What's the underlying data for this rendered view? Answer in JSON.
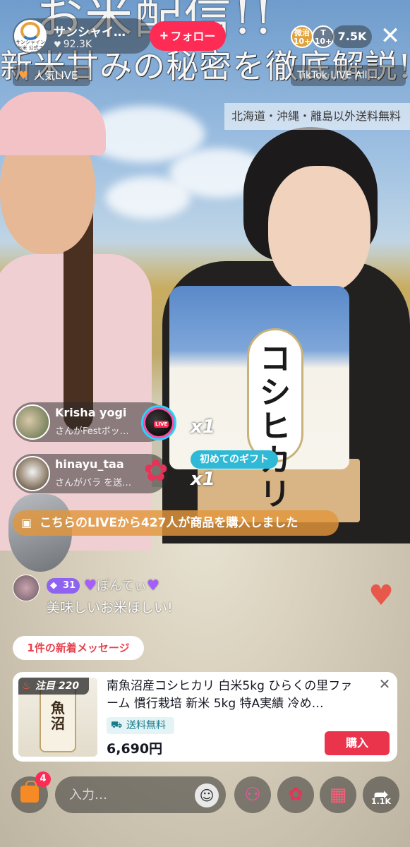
{
  "stream": {
    "overlay_title": "お米配信!!",
    "overlay_subtitle": "新米甘みの秘密を徹底解説!",
    "shipping_banner": "北海道・沖縄・離島以外送料無料",
    "bag_kanji": "コシヒカリ"
  },
  "host": {
    "name": "サンシャイ…",
    "avatar_text": "サンシャインお米 公式ストア",
    "likes": "92.3K",
    "follow_label": "フォロー"
  },
  "top_right": {
    "badge_a": "微治 10+",
    "badge_b": "T 10+",
    "viewers": "7.5K"
  },
  "tags": {
    "popular": "人気LIVE",
    "tiktok": "TikTok LIVE All …"
  },
  "gifts": [
    {
      "user": "Krisha yogi",
      "message": "さんがFestボッ…",
      "combo": "x1",
      "icon": "live-ball-icon"
    },
    {
      "user": "hinayu_taa",
      "message": "さんがバラ を送…",
      "combo": "x1",
      "icon": "rose-icon"
    }
  ],
  "first_gift_label": "初めてのギフト",
  "purchase_banner": "こちらのLIVEから427人が商品を購入しました",
  "comment": {
    "level": "31",
    "user": "ぽんてぃ",
    "text": "美味しいお米ほしい!"
  },
  "new_messages": "1件の新着メッセージ",
  "product": {
    "hot_label": "注目 220",
    "title": "南魚沼産コシヒカリ 白米5kg ひらくの里ファーム 慣行栽培 新米 5kg 特A実績 冷め…",
    "thumb_text": "魚沼",
    "shipping": "送料無料",
    "price": "6,690円",
    "buy_label": "購入"
  },
  "bottom_bar": {
    "cart_count": "4",
    "input_placeholder": "入力…",
    "share_count": "1.1K"
  },
  "colors": {
    "accent": "#fe2c55",
    "purchase_banner": "#e2963c",
    "first_gift": "#2fb9d6",
    "level_badge": "#8e63f0",
    "buy_button": "#e9344c"
  }
}
